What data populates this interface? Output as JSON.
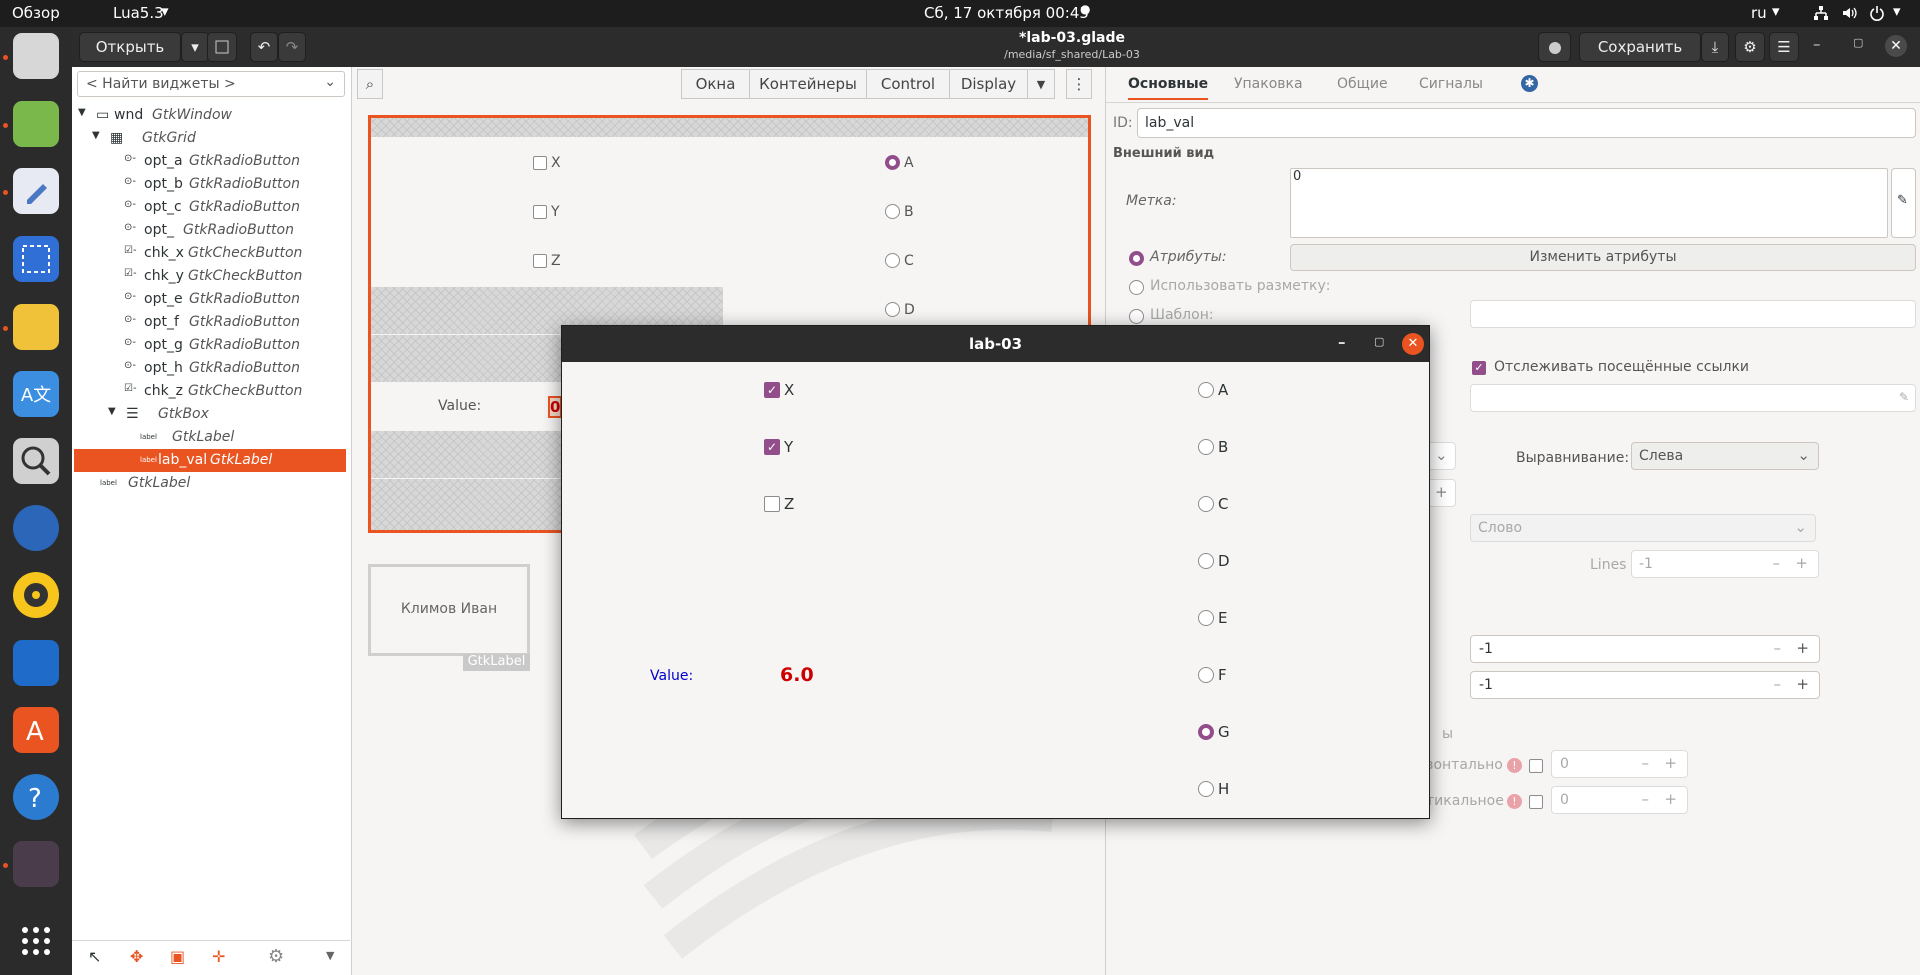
{
  "topbar": {
    "activities": "Обзор",
    "app_menu": "Lua5.3",
    "clock": "Сб, 17 октября  00:45",
    "lang": "ru"
  },
  "header": {
    "open_label": "Открыть",
    "title": "*lab-03.glade",
    "subtitle": "/media/sf_shared/Lab-03",
    "save_label": "Сохранить"
  },
  "widget_search": {
    "placeholder": "< Найти виджеты >"
  },
  "tree": [
    {
      "name": "wnd",
      "cls": "GtkWindow"
    },
    {
      "name": "",
      "cls": "GtkGrid"
    },
    {
      "name": "opt_a",
      "cls": "GtkRadioButton"
    },
    {
      "name": "opt_b",
      "cls": "GtkRadioButton"
    },
    {
      "name": "opt_c",
      "cls": "GtkRadioButton"
    },
    {
      "name": "opt_",
      "cls": "GtkRadioButton"
    },
    {
      "name": "chk_x",
      "cls": "GtkCheckButton"
    },
    {
      "name": "chk_y",
      "cls": "GtkCheckButton"
    },
    {
      "name": "opt_e",
      "cls": "GtkRadioButton"
    },
    {
      "name": "opt_f",
      "cls": "GtkRadioButton"
    },
    {
      "name": "opt_g",
      "cls": "GtkRadioButton"
    },
    {
      "name": "opt_h",
      "cls": "GtkRadioButton"
    },
    {
      "name": "chk_z",
      "cls": "GtkCheckButton"
    },
    {
      "name": "",
      "cls": "GtkBox"
    },
    {
      "name": "",
      "cls": "GtkLabel"
    },
    {
      "name": "lab_val",
      "cls": "GtkLabel"
    },
    {
      "name": "",
      "cls": "GtkLabel"
    }
  ],
  "palette": {
    "tabs": [
      "Окна",
      "Контейнеры",
      "Control",
      "Display"
    ]
  },
  "canvas": {
    "checks": [
      "X",
      "Y",
      "Z"
    ],
    "radios": [
      "A",
      "B",
      "C",
      "D"
    ],
    "value_label": "Value:",
    "value": "0",
    "name_label": "Климов Иван",
    "name_tag": "GtkLabel"
  },
  "props": {
    "tabs": [
      "Основные",
      "Упаковка",
      "Общие",
      "Сигналы"
    ],
    "id_label": "ID:",
    "id_value": "lab_val",
    "appearance": "Внешний вид",
    "label_label": "Метка:",
    "label_value": "0",
    "attrs_label": "Атрибуты:",
    "attrs_button": "Изменить атрибуты",
    "markup_label": "Использовать разметку:",
    "template_label": "Шаблон:",
    "track_links": "Отслеживать посещённые ссылки",
    "align_label": "Выравнивание:",
    "align_value": "Слева",
    "wrap_value": "Слово",
    "lines_label": "Lines",
    "lines_value": "-1",
    "num1": "-1",
    "num2": "-1",
    "hidden_tail": "ы",
    "horiz": "зонтально",
    "vert": "тикальное",
    "pad1": "0",
    "pad2": "0"
  },
  "dialog": {
    "title": "lab-03",
    "checks": [
      {
        "label": "X",
        "checked": true
      },
      {
        "label": "Y",
        "checked": true
      },
      {
        "label": "Z",
        "checked": false
      }
    ],
    "radios": [
      {
        "label": "A",
        "on": false
      },
      {
        "label": "B",
        "on": false
      },
      {
        "label": "C",
        "on": false
      },
      {
        "label": "D",
        "on": false
      },
      {
        "label": "E",
        "on": false
      },
      {
        "label": "F",
        "on": false
      },
      {
        "label": "G",
        "on": true
      },
      {
        "label": "H",
        "on": false
      }
    ],
    "value_label": "Value:",
    "value": "6.0"
  },
  "colors": {
    "accent": "#e95420",
    "check": "#924d8b",
    "value_blue": "#0000cc",
    "value_red": "#cc0000"
  }
}
